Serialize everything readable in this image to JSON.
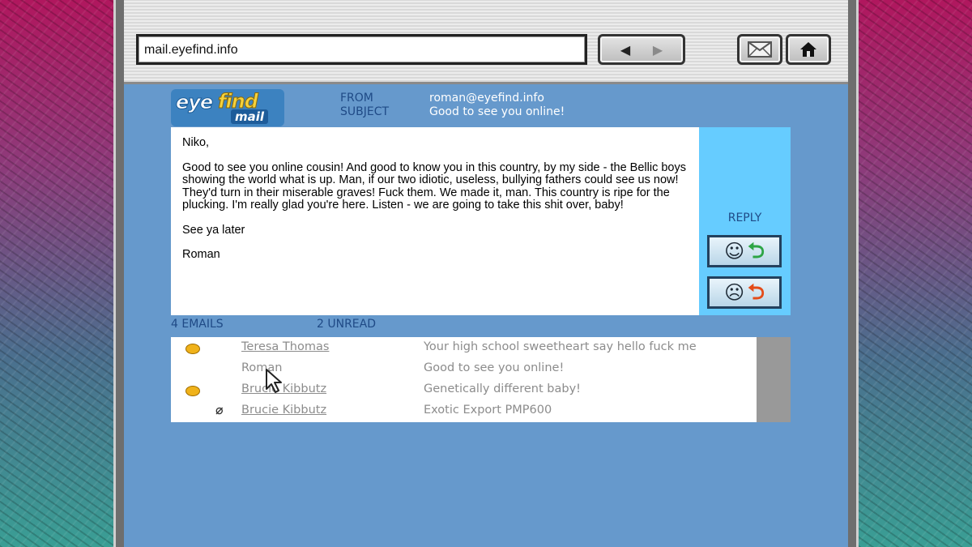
{
  "browser": {
    "address": "mail.eyefind.info",
    "icons": {
      "back": "back-arrow-icon",
      "forward": "forward-arrow-icon",
      "mail": "envelope-icon",
      "home": "home-icon"
    }
  },
  "logo": {
    "part1": "eye",
    "part2": "find",
    "part3": "mail"
  },
  "message": {
    "from_label": "FROM",
    "from_value": "roman@eyefind.info",
    "subject_label": "SUBJECT",
    "subject_value": "Good to see you online!",
    "greeting": "Niko,",
    "body": "Good to see you online cousin! And good to know you in this country, by my side - the Bellic boys showing the world what is up. Man, if our two idiotic, useless, bullying fathers could see us now! They'd turn in their miserable graves! Fuck them. We made it, man. This country is ripe for the plucking. I'm really glad you're here. Listen - we are going to take this shit over, baby!",
    "signoff": "See ya later",
    "signature": "Roman"
  },
  "reply": {
    "label": "REPLY",
    "positive_icon": "happy-face-reply-icon",
    "negative_icon": "sad-face-reply-icon"
  },
  "inbox": {
    "email_count": "4 EMAILS",
    "unread_count": "2 UNREAD",
    "emails": [
      {
        "sender": "Teresa Thomas",
        "subject": "Your high school sweetheart say hello fuck me",
        "unread": true,
        "attachment": false
      },
      {
        "sender": "Roman",
        "subject": "Good to see you online!",
        "unread": false,
        "attachment": false
      },
      {
        "sender": "Brucie Kibbutz",
        "subject": "Genetically different baby!",
        "unread": true,
        "attachment": false
      },
      {
        "sender": "Brucie Kibbutz",
        "subject": "Exotic Export PMP600",
        "unread": false,
        "attachment": true
      }
    ]
  },
  "colors": {
    "page_bg": "#6699cc",
    "reply_panel": "#66ccff",
    "label_text": "#1f4a86",
    "unread_dot": "#f0b21a"
  }
}
